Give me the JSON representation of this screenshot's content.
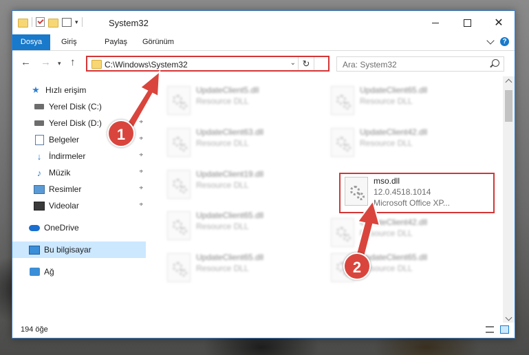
{
  "window": {
    "title": "System32",
    "qat": {
      "dropdown_glyph": "▾"
    },
    "controls": {
      "close_glyph": "✕"
    }
  },
  "ribbon": {
    "tabs": [
      {
        "label": "Dosya"
      },
      {
        "label": "Giriş"
      },
      {
        "label": "Paylaş"
      },
      {
        "label": "Görünüm"
      }
    ],
    "help_glyph": "?"
  },
  "nav": {
    "back_glyph": "←",
    "forward_glyph": "→",
    "recent_glyph": "▾",
    "up_glyph": "↑",
    "address_path": "C:\\Windows\\System32",
    "address_dropdown_glyph": "⌄",
    "refresh_glyph": "↻",
    "search_placeholder": "Ara: System32"
  },
  "sidebar": {
    "items": [
      {
        "label": "Hızlı erişim",
        "icon": "star-icon",
        "glyph": "★"
      },
      {
        "label": "Yerel Disk (C:)",
        "icon": "drive-icon",
        "pinned": true
      },
      {
        "label": "Yerel Disk (D:)",
        "icon": "drive-icon",
        "pinned": true
      },
      {
        "label": "Belgeler",
        "icon": "documents-icon",
        "pinned": true
      },
      {
        "label": "İndirmeler",
        "icon": "download-icon",
        "glyph": "↓",
        "pinned": true
      },
      {
        "label": "Müzik",
        "icon": "music-icon",
        "glyph": "♪",
        "pinned": true
      },
      {
        "label": "Resimler",
        "icon": "pictures-icon",
        "pinned": true
      },
      {
        "label": "Videolar",
        "icon": "videos-icon",
        "pinned": true
      },
      {
        "label": "OneDrive",
        "icon": "cloud-icon"
      },
      {
        "label": "Bu bilgisayar",
        "icon": "computer-icon",
        "selected": true
      },
      {
        "label": "Ağ",
        "icon": "network-icon"
      }
    ],
    "pin_glyph": "⌖"
  },
  "files": [
    {
      "name": "UpdateClient5.dll",
      "desc": "Resource DLL",
      "blurred": true
    },
    {
      "name": "UpdateClient65.dll",
      "desc": "Resource DLL",
      "blurred": true
    },
    {
      "name": "UpdateClient63.dll",
      "desc": "Resource DLL",
      "blurred": true
    },
    {
      "name": "UpdateClient42.dll",
      "desc": "Resource DLL",
      "blurred": true
    },
    {
      "name": "UpdateClient19.dll",
      "desc": "Resource DLL",
      "blurred": true
    },
    {
      "name": "mso.dll",
      "desc": "12.0.4518.1014",
      "desc2": "Microsoft Office XP...",
      "blurred": false
    },
    {
      "name": "UpdateClient65.dll",
      "desc": "Resource DLL",
      "blurred": true
    },
    {
      "name": "UpdateClient42.dll",
      "desc": "Resource DLL",
      "blurred": true
    },
    {
      "name": "UpdateClient65.dll",
      "desc": "Resource DLL",
      "blurred": true
    },
    {
      "name": "UpdateClient65.dll",
      "desc": "Resource DLL",
      "blurred": true
    }
  ],
  "status": {
    "item_count": "194 öğe"
  },
  "callouts": [
    {
      "number": "1",
      "color": "#d9453c"
    },
    {
      "number": "2",
      "color": "#d9453c"
    }
  ],
  "colors": {
    "accent": "#1979ca",
    "highlight": "#d43535",
    "selected_bg": "#cce8ff"
  }
}
